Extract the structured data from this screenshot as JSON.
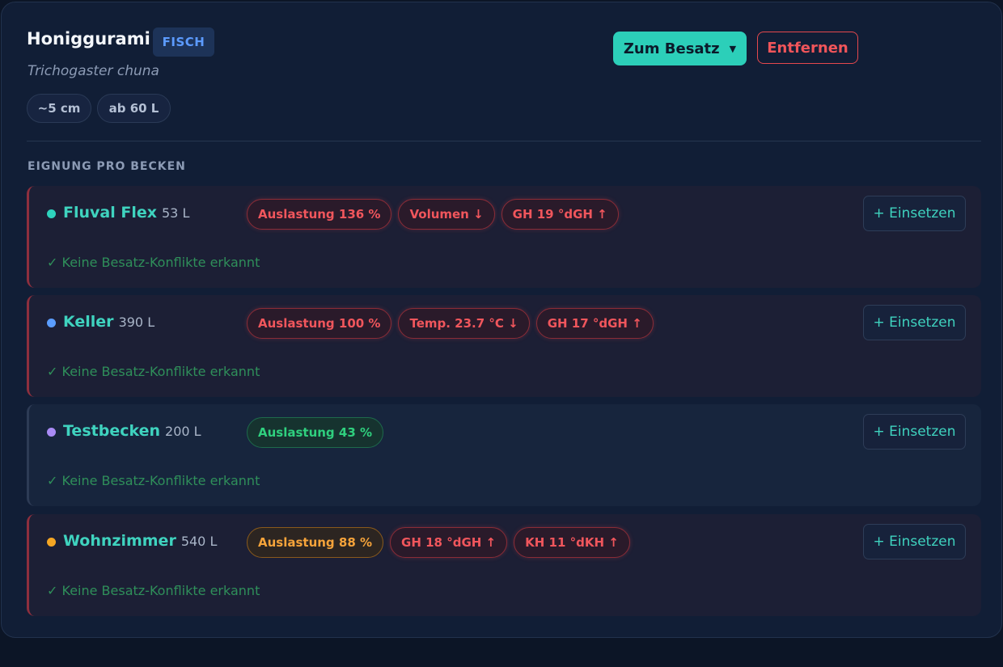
{
  "fish": {
    "name": "Honiggurami",
    "type_badge": "FISCH",
    "latin_name": "Trichogaster chuna",
    "size": "~5 cm",
    "min_volume": "ab 60 L"
  },
  "actions": {
    "to_stock_label": "Zum Besatz",
    "caret": "▼",
    "remove_label": "Entfernen"
  },
  "section_label": "EIGNUNG PRO BECKEN",
  "insert_label": "+ Einsetzen",
  "tanks": [
    {
      "name": "Fluval Flex",
      "volume": "53 L",
      "dot_color": "#2ed3bd",
      "tags": [
        {
          "text": "Auslastung 136 %",
          "status": "bad"
        },
        {
          "text": "Volumen ↓",
          "status": "bad"
        },
        {
          "text": "GH 19 °dGH ↑",
          "status": "bad"
        }
      ],
      "note": "✓ Keine Besatz-Konflikte erkannt"
    },
    {
      "name": "Keller",
      "volume": "390 L",
      "dot_color": "#5b9dff",
      "tags": [
        {
          "text": "Auslastung 100 %",
          "status": "bad"
        },
        {
          "text": "Temp. 23.7 °C ↓",
          "status": "bad"
        },
        {
          "text": "GH 17 °dGH ↑",
          "status": "bad"
        }
      ],
      "note": "✓ Keine Besatz-Konflikte erkannt"
    },
    {
      "name": "Testbecken",
      "volume": "200 L",
      "dot_color": "#a98bf5",
      "tags": [
        {
          "text": "Auslastung 43 %",
          "status": "good"
        }
      ],
      "note": "✓ Keine Besatz-Konflikte erkannt"
    },
    {
      "name": "Wohnzimmer",
      "volume": "540 L",
      "dot_color": "#f5a623",
      "tags": [
        {
          "text": "Auslastung 88 %",
          "status": "warn"
        },
        {
          "text": "GH 18 °dGH ↑",
          "status": "bad"
        },
        {
          "text": "KH 11 °dKH ↑",
          "status": "bad"
        }
      ],
      "note": "✓ Keine Besatz-Konflikte erkannt"
    }
  ]
}
